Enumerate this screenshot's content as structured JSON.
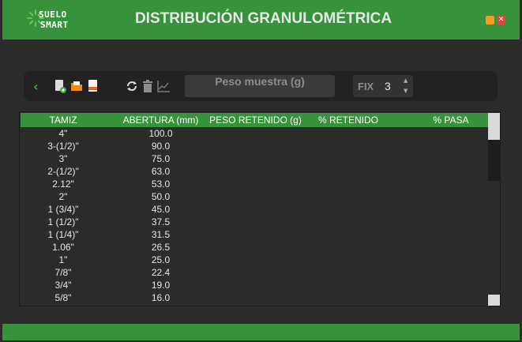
{
  "app": {
    "logo_line1": "SUELO",
    "logo_line2": "SMART",
    "title": "DISTRIBUCIÓN GRANULOMÉTRICA",
    "close_glyph": "✕"
  },
  "toolbar": {
    "back_glyph": "‹",
    "icons": [
      "new-document-icon",
      "open-folder-icon",
      "save-file-icon",
      "refresh-icon",
      "trash-icon",
      "chart-icon"
    ],
    "weight_placeholder": "Peso muestra (g)",
    "fix_label": "FIX",
    "fix_value": "3",
    "spin_up": "▲",
    "spin_down": "▼"
  },
  "table": {
    "headers": [
      "TAMIZ",
      "ABERTURA (mm)",
      "PESO RETENIDO (g)",
      "% RETENIDO",
      "% PASA"
    ],
    "rows": [
      {
        "tamiz": "4\"",
        "abertura": "100.0"
      },
      {
        "tamiz": "3-(1/2)\"",
        "abertura": "90.0"
      },
      {
        "tamiz": "3\"",
        "abertura": "75.0"
      },
      {
        "tamiz": "2-(1/2)\"",
        "abertura": "63.0"
      },
      {
        "tamiz": "2.12\"",
        "abertura": "53.0"
      },
      {
        "tamiz": "2\"",
        "abertura": "50.0"
      },
      {
        "tamiz": "1 (3/4)\"",
        "abertura": "45.0"
      },
      {
        "tamiz": "1 (1/2)\"",
        "abertura": "37.5"
      },
      {
        "tamiz": "1 (1/4)\"",
        "abertura": "31.5"
      },
      {
        "tamiz": "1.06\"",
        "abertura": "26.5"
      },
      {
        "tamiz": "1\"",
        "abertura": "25.0"
      },
      {
        "tamiz": "7/8\"",
        "abertura": "22.4"
      },
      {
        "tamiz": "3/4\"",
        "abertura": "19.0"
      },
      {
        "tamiz": "5/8\"",
        "abertura": "16.0"
      }
    ]
  },
  "colors": {
    "accent": "#36923b",
    "background": "#2b2b2b",
    "toolbar": "#222222"
  }
}
